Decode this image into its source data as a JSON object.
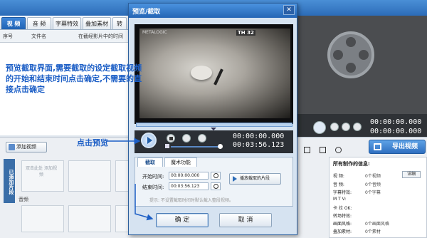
{
  "app": {
    "tabs": [
      {
        "label": "视 频",
        "active": true
      },
      {
        "label": "音 频",
        "active": false
      },
      {
        "label": "字幕特效",
        "active": false
      },
      {
        "label": "叠加素材",
        "active": false
      },
      {
        "label": "转",
        "active": false
      }
    ],
    "list_headers": [
      "序号",
      "文件名",
      "在截经影片中的时间"
    ],
    "add_video": "添加视频",
    "track_label": "已添加片段",
    "slot_text": "双击此处\n添加视频",
    "audio_label": "音频",
    "right_time_start": "00:00:00.000",
    "right_time_end": "00:00:00.000",
    "export": "导出视频",
    "info_title": "所有制作的信息:",
    "detail": "详细",
    "info_rows": [
      {
        "label": "视  频:",
        "value": "0个视频"
      },
      {
        "label": "音  频:",
        "value": "0个音频"
      },
      {
        "label": "字幕特效:",
        "value": "0个字幕"
      },
      {
        "label": "M  T  V:",
        "value": ""
      },
      {
        "label": "卡  拉 OK:",
        "value": ""
      },
      {
        "label": "转场特效:",
        "value": ""
      },
      {
        "label": "画面风格:",
        "value": "0个画面风格"
      },
      {
        "label": "叠加素材:",
        "value": "0个素材"
      }
    ]
  },
  "dialog": {
    "title": "预览/截取",
    "close": "✕",
    "logo_left": "METALOGIC",
    "logo_right": "TH 32",
    "time_start": "00:00:00.000",
    "time_end": "00:03:56.123",
    "tabs": [
      "截取",
      "魔术功能"
    ],
    "start_label": "开始时间:",
    "start_value": "00:00:00.000",
    "end_label": "结束时间:",
    "end_value": "00:03:56.123",
    "play_cut": "播放截取的片段",
    "hint": "提示: 不设置截取时间时默认截入整段视频。",
    "ok": "确 定",
    "cancel": "取 消"
  },
  "annotations": {
    "note1": "预览截取界面,需要截取的设定截取视频的开始和结束时间点击确定,不需要的直接点击确定",
    "note2": "点击预览"
  },
  "colors": {
    "accent": "#2465b5",
    "annotation": "#1d5fc6"
  }
}
